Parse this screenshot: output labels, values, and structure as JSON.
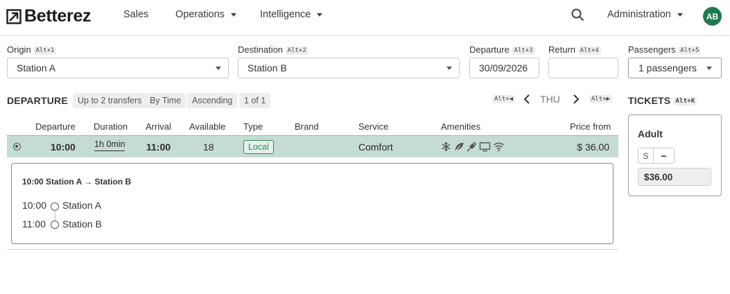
{
  "app": {
    "brand": "Betterez",
    "avatar_initials": "AB",
    "accent_color": "#1e7a4c"
  },
  "nav": {
    "sales": "Sales",
    "operations": "Operations",
    "intelligence": "Intelligence",
    "administration": "Administration"
  },
  "search_form": {
    "origin": {
      "label": "Origin",
      "shortcut": "Alt+1",
      "value": "Station A"
    },
    "destination": {
      "label": "Destination",
      "shortcut": "Alt+2",
      "value": "Station B"
    },
    "departure": {
      "label": "Departure",
      "shortcut": "Alt+3",
      "value": "30/09/2026"
    },
    "return": {
      "label": "Return",
      "shortcut": "Alt+4",
      "value": ""
    },
    "passengers": {
      "label": "Passengers",
      "shortcut": "Alt+5",
      "value": "1 passengers"
    }
  },
  "results": {
    "title": "DEPARTURE",
    "chips": [
      "Up to 2 transfers",
      "By Time",
      "Ascending",
      "1 of 1"
    ],
    "prev_shortcut": "Alt+◀",
    "next_shortcut": "Alt+▶",
    "day": "THU",
    "columns": [
      "Departure",
      "Duration",
      "Arrival",
      "Available",
      "Type",
      "Brand",
      "Service",
      "Amenities",
      "Price from"
    ],
    "rows": [
      {
        "departure": "10:00",
        "duration": "1h 0min",
        "arrival": "11:00",
        "available": "18",
        "type": "Local",
        "brand": "",
        "service": "Comfort",
        "amenities": [
          "snowflake-icon",
          "leaf-icon",
          "plug-icon",
          "monitor-icon",
          "wifi-icon"
        ],
        "price": "$ 36.00"
      }
    ],
    "details": {
      "title": "10:00 Station A → Station B",
      "stops": [
        {
          "time": "10:00",
          "name": "Station A"
        },
        {
          "time": "11:00",
          "name": "Station B"
        }
      ]
    }
  },
  "tickets": {
    "title": "TICKETS",
    "shortcut": "Alt+K",
    "passenger_type": "Adult",
    "seat_label": "S",
    "minus_label": "−",
    "price": "$36.00"
  }
}
